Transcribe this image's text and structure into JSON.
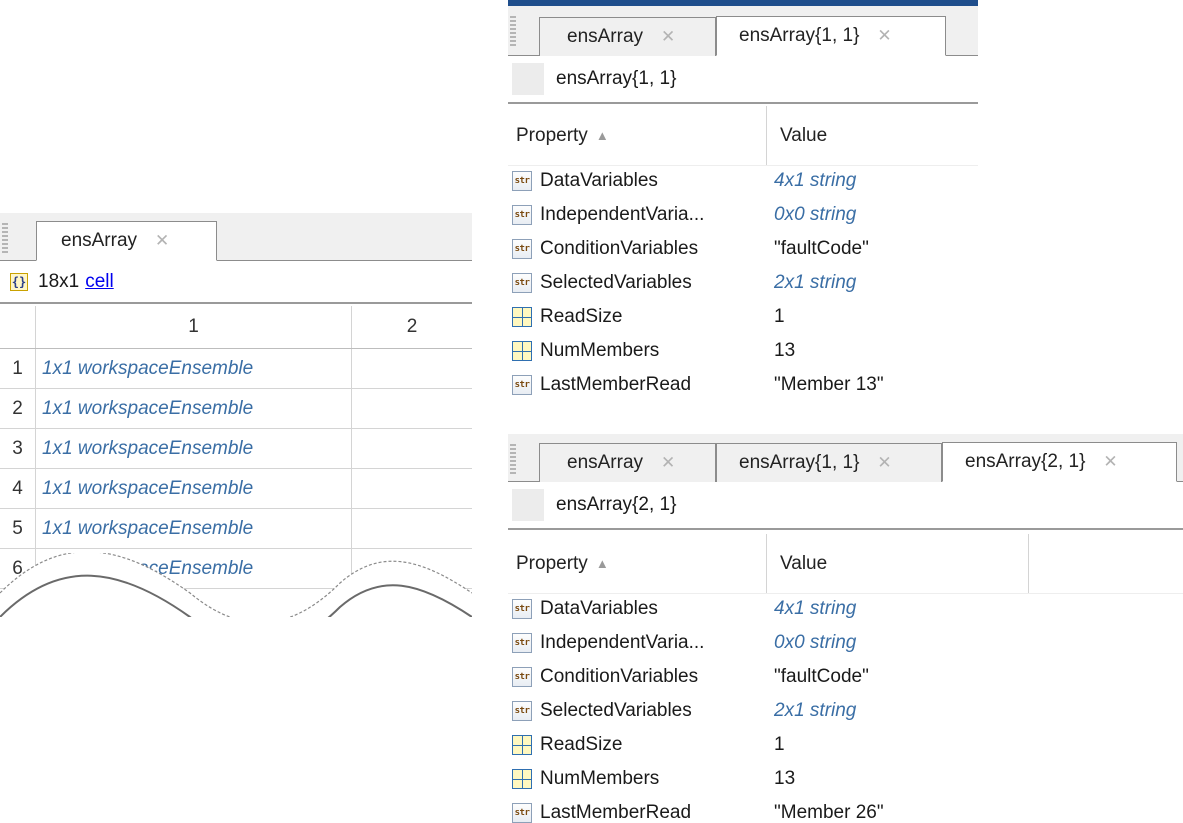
{
  "left": {
    "tabs": [
      {
        "label": "ensArray",
        "close": "✕"
      }
    ],
    "info": {
      "icon": "{}",
      "size": "18x1",
      "type_link": "cell"
    },
    "columns": [
      "1",
      "2"
    ],
    "rows": [
      {
        "index": "1",
        "value": "1x1 workspaceEnsemble"
      },
      {
        "index": "2",
        "value": "1x1 workspaceEnsemble"
      },
      {
        "index": "3",
        "value": "1x1 workspaceEnsemble"
      },
      {
        "index": "4",
        "value": "1x1 workspaceEnsemble"
      },
      {
        "index": "5",
        "value": "1x1 workspaceEnsemble"
      },
      {
        "index": "6",
        "value": "1x1 workspaceEnsemble"
      }
    ]
  },
  "panel1": {
    "tabs": [
      {
        "label": "ensArray",
        "close": "✕"
      },
      {
        "label": "ensArray{1, 1}",
        "close": "✕"
      }
    ],
    "breadcrumb": "ensArray{1, 1}",
    "header": {
      "property": "Property",
      "sort": "▲",
      "value": "Value"
    },
    "rows": [
      {
        "icon": "string-icon",
        "icon_text": "str",
        "name": "DataVariables",
        "value": "4x1 string",
        "style": "italic"
      },
      {
        "icon": "string-icon",
        "icon_text": "str",
        "name": "IndependentVaria...",
        "value": "0x0 string",
        "style": "italic"
      },
      {
        "icon": "string-icon",
        "icon_text": "str",
        "name": "ConditionVariables",
        "value": "\"faultCode\"",
        "style": "plain"
      },
      {
        "icon": "string-icon",
        "icon_text": "str",
        "name": "SelectedVariables",
        "value": "2x1 string",
        "style": "italic"
      },
      {
        "icon": "numeric-icon",
        "icon_text": "",
        "name": "ReadSize",
        "value": "1",
        "style": "plain"
      },
      {
        "icon": "numeric-icon",
        "icon_text": "",
        "name": "NumMembers",
        "value": "13",
        "style": "plain"
      },
      {
        "icon": "string-icon",
        "icon_text": "str",
        "name": "LastMemberRead",
        "value": "\"Member 13\"",
        "style": "plain"
      }
    ]
  },
  "panel2": {
    "tabs": [
      {
        "label": "ensArray",
        "close": "✕"
      },
      {
        "label": "ensArray{1, 1}",
        "close": "✕"
      },
      {
        "label": "ensArray{2, 1}",
        "close": "✕"
      }
    ],
    "breadcrumb": "ensArray{2, 1}",
    "header": {
      "property": "Property",
      "sort": "▲",
      "value": "Value"
    },
    "rows": [
      {
        "icon": "string-icon",
        "icon_text": "str",
        "name": "DataVariables",
        "value": "4x1 string",
        "style": "italic"
      },
      {
        "icon": "string-icon",
        "icon_text": "str",
        "name": "IndependentVaria...",
        "value": "0x0 string",
        "style": "italic"
      },
      {
        "icon": "string-icon",
        "icon_text": "str",
        "name": "ConditionVariables",
        "value": "\"faultCode\"",
        "style": "plain"
      },
      {
        "icon": "string-icon",
        "icon_text": "str",
        "name": "SelectedVariables",
        "value": "2x1 string",
        "style": "italic"
      },
      {
        "icon": "numeric-icon",
        "icon_text": "",
        "name": "ReadSize",
        "value": "1",
        "style": "plain"
      },
      {
        "icon": "numeric-icon",
        "icon_text": "",
        "name": "NumMembers",
        "value": "13",
        "style": "plain"
      },
      {
        "icon": "string-icon",
        "icon_text": "str",
        "name": "LastMemberRead",
        "value": "\"Member 26\"",
        "style": "plain"
      }
    ]
  }
}
